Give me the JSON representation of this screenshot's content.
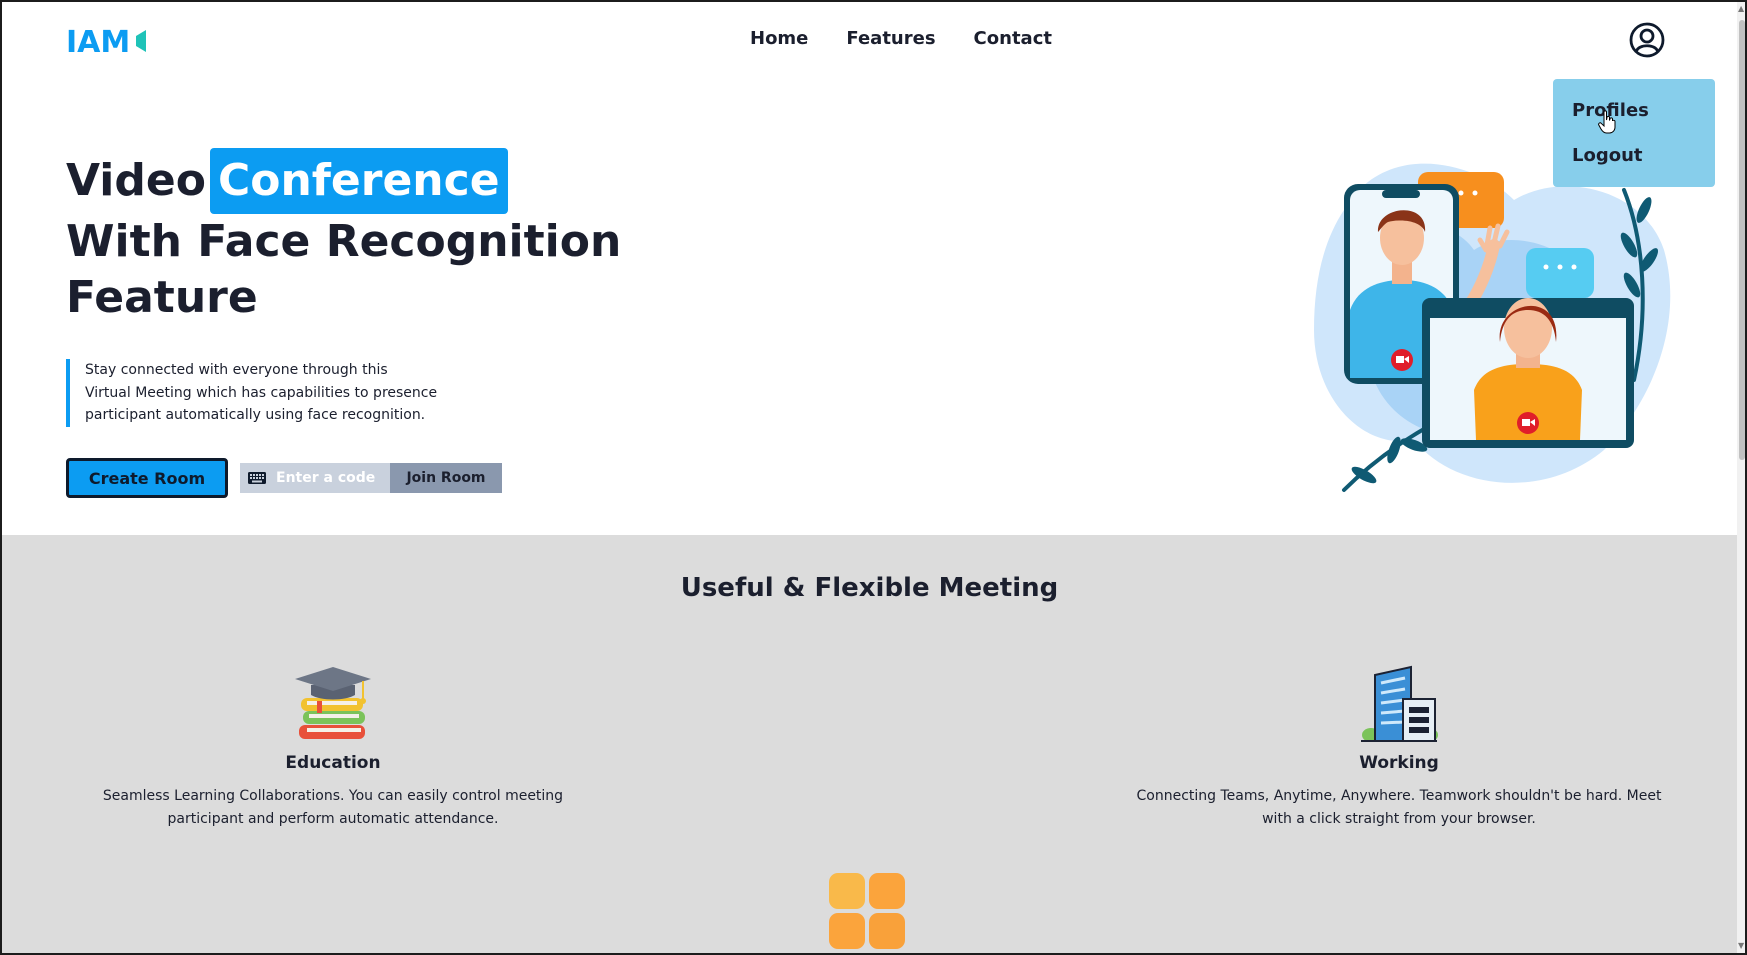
{
  "header": {
    "logo_text": "IAM",
    "nav": [
      "Home",
      "Features",
      "Contact"
    ]
  },
  "dropdown": {
    "items": [
      "Profiles",
      "Logout"
    ]
  },
  "hero": {
    "title_word1": "Video",
    "title_highlight": "Conference",
    "title_line2": "With Face Recognition",
    "title_line3": "Feature",
    "description": [
      "Stay connected with everyone through this",
      "Virtual Meeting which has capabilities to presence",
      "participant automatically using face recognition."
    ],
    "create_button": "Create Room",
    "code_placeholder": "Enter a code",
    "join_button": "Join Room"
  },
  "features": {
    "heading": "Useful & Flexible Meeting",
    "items": [
      {
        "icon": "graduation-books-icon",
        "title": "Education",
        "text": "Seamless Learning Collaborations. You can easily control meeting participant and perform automatic attendance."
      },
      {
        "icon": "office-building-icon",
        "title": "Working",
        "text": "Connecting Teams, Anytime, Anywhere. Teamwork shouldn't be hard. Meet with a click straight from your browser."
      }
    ]
  },
  "colors": {
    "accent": "#0c9cf2",
    "dropdown_bg": "#87ceeb",
    "section_bg": "#dcdcdc",
    "text": "#1b1f2e"
  }
}
